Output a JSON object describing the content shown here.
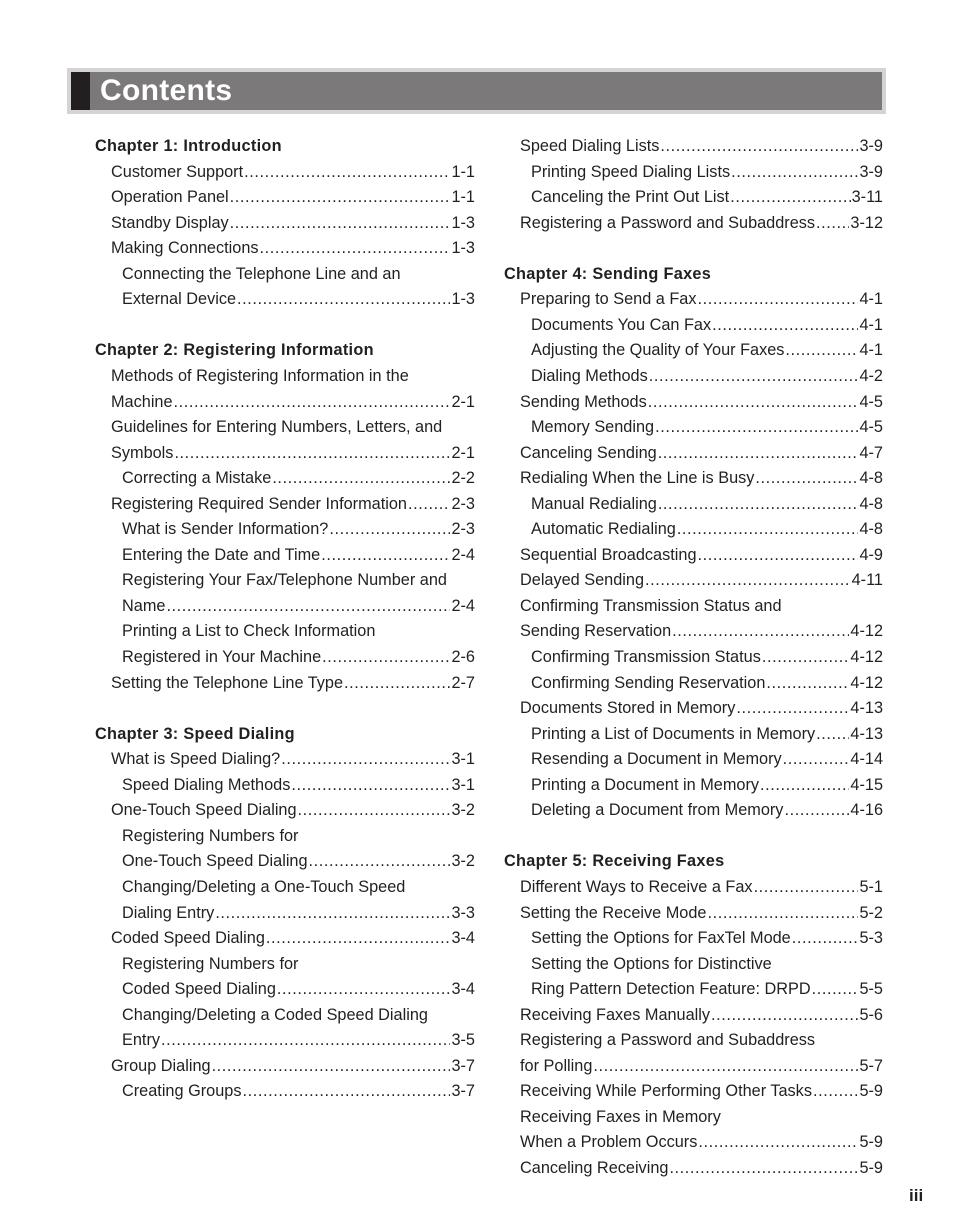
{
  "header": {
    "title": "Contents"
  },
  "page_number": "iii",
  "columns": [
    {
      "lines": [
        {
          "type": "chapter",
          "text": "Chapter 1: Introduction"
        },
        {
          "type": "entry",
          "level": 1,
          "text": "Customer Support",
          "page": "1-1"
        },
        {
          "type": "entry",
          "level": 1,
          "text": "Operation Panel",
          "page": "1-1"
        },
        {
          "type": "entry",
          "level": 1,
          "text": "Standby Display",
          "page": "1-3"
        },
        {
          "type": "entry",
          "level": 1,
          "text": "Making Connections",
          "page": "1-3"
        },
        {
          "type": "text",
          "level": 2,
          "text": "Connecting the Telephone Line and an"
        },
        {
          "type": "entry",
          "level": 2,
          "text": "External Device",
          "page": "1-3"
        },
        {
          "type": "blank"
        },
        {
          "type": "chapter",
          "text": "Chapter 2: Registering Information"
        },
        {
          "type": "text",
          "level": 1,
          "text": "Methods of Registering Information in the"
        },
        {
          "type": "entry",
          "level": 1,
          "text": "Machine",
          "page": "2-1"
        },
        {
          "type": "text",
          "level": 1,
          "text": "Guidelines for Entering Numbers, Letters, and"
        },
        {
          "type": "entry",
          "level": 1,
          "text": "Symbols",
          "page": "2-1"
        },
        {
          "type": "entry",
          "level": 2,
          "text": "Correcting a Mistake",
          "page": "2-2"
        },
        {
          "type": "entry",
          "level": 1,
          "text": "Registering Required Sender Information",
          "page": "2-3"
        },
        {
          "type": "entry",
          "level": 2,
          "text": "What is Sender Information?",
          "page": "2-3"
        },
        {
          "type": "entry",
          "level": 2,
          "text": "Entering the Date and Time",
          "page": "2-4"
        },
        {
          "type": "text",
          "level": 2,
          "text": "Registering Your Fax/Telephone Number and"
        },
        {
          "type": "entry",
          "level": 2,
          "text": "Name",
          "page": "2-4"
        },
        {
          "type": "text",
          "level": 2,
          "text": "Printing a List to Check Information"
        },
        {
          "type": "entry",
          "level": 2,
          "text": "Registered in Your Machine",
          "page": "2-6"
        },
        {
          "type": "entry",
          "level": 1,
          "text": "Setting the Telephone Line Type",
          "page": "2-7"
        },
        {
          "type": "blank"
        },
        {
          "type": "chapter",
          "text": "Chapter 3: Speed Dialing"
        },
        {
          "type": "entry",
          "level": 1,
          "text": "What is Speed Dialing?",
          "page": "3-1"
        },
        {
          "type": "entry",
          "level": 2,
          "text": "Speed Dialing Methods",
          "page": "3-1"
        },
        {
          "type": "entry",
          "level": 1,
          "text": "One-Touch Speed Dialing",
          "page": "3-2"
        },
        {
          "type": "text",
          "level": 2,
          "text": "Registering Numbers for"
        },
        {
          "type": "entry",
          "level": 2,
          "text": "One-Touch Speed Dialing",
          "page": "3-2"
        },
        {
          "type": "text",
          "level": 2,
          "text": "Changing/Deleting a One-Touch Speed"
        },
        {
          "type": "entry",
          "level": 2,
          "text": "Dialing Entry",
          "page": "3-3"
        },
        {
          "type": "entry",
          "level": 1,
          "text": "Coded Speed Dialing",
          "page": "3-4"
        },
        {
          "type": "text",
          "level": 2,
          "text": "Registering Numbers for"
        },
        {
          "type": "entry",
          "level": 2,
          "text": "Coded Speed Dialing",
          "page": "3-4"
        },
        {
          "type": "text",
          "level": 2,
          "text": "Changing/Deleting a Coded Speed Dialing"
        },
        {
          "type": "entry",
          "level": 2,
          "text": "Entry",
          "page": "3-5"
        },
        {
          "type": "entry",
          "level": 1,
          "text": "Group Dialing",
          "page": "3-7"
        },
        {
          "type": "entry",
          "level": 2,
          "text": "Creating Groups",
          "page": "3-7"
        }
      ]
    },
    {
      "lines": [
        {
          "type": "entry",
          "level": 1,
          "text": "Speed Dialing Lists",
          "page": "3-9"
        },
        {
          "type": "entry",
          "level": 2,
          "text": "Printing Speed Dialing Lists",
          "page": "3-9"
        },
        {
          "type": "entry",
          "level": 2,
          "text": "Canceling the Print Out List",
          "page": "3-11"
        },
        {
          "type": "entry",
          "level": 1,
          "text": "Registering a Password and Subaddress",
          "page": "3-12"
        },
        {
          "type": "blank"
        },
        {
          "type": "chapter",
          "text": "Chapter 4: Sending Faxes"
        },
        {
          "type": "entry",
          "level": 1,
          "text": "Preparing to Send a Fax",
          "page": "4-1"
        },
        {
          "type": "entry",
          "level": 2,
          "text": "Documents You Can Fax",
          "page": "4-1"
        },
        {
          "type": "entry",
          "level": 2,
          "text": "Adjusting the Quality of Your Faxes",
          "page": "4-1"
        },
        {
          "type": "entry",
          "level": 2,
          "text": "Dialing Methods",
          "page": "4-2"
        },
        {
          "type": "entry",
          "level": 1,
          "text": "Sending Methods",
          "page": "4-5"
        },
        {
          "type": "entry",
          "level": 2,
          "text": "Memory Sending",
          "page": "4-5"
        },
        {
          "type": "entry",
          "level": 1,
          "text": "Canceling Sending",
          "page": "4-7"
        },
        {
          "type": "entry",
          "level": 1,
          "text": "Redialing When the Line is Busy",
          "page": "4-8"
        },
        {
          "type": "entry",
          "level": 2,
          "text": "Manual Redialing",
          "page": "4-8"
        },
        {
          "type": "entry",
          "level": 2,
          "text": "Automatic Redialing",
          "page": "4-8"
        },
        {
          "type": "entry",
          "level": 1,
          "text": "Sequential Broadcasting",
          "page": "4-9"
        },
        {
          "type": "entry",
          "level": 1,
          "text": "Delayed Sending",
          "page": "4-11"
        },
        {
          "type": "text",
          "level": 1,
          "text": "Confirming Transmission Status and"
        },
        {
          "type": "entry",
          "level": 1,
          "text": "Sending Reservation",
          "page": "4-12"
        },
        {
          "type": "entry",
          "level": 2,
          "text": "Confirming Transmission Status",
          "page": "4-12"
        },
        {
          "type": "entry",
          "level": 2,
          "text": "Confirming Sending Reservation",
          "page": "4-12"
        },
        {
          "type": "entry",
          "level": 1,
          "text": "Documents Stored in Memory",
          "page": "4-13"
        },
        {
          "type": "entry",
          "level": 2,
          "text": "Printing a List of Documents in Memory",
          "page": "4-13"
        },
        {
          "type": "entry",
          "level": 2,
          "text": "Resending a Document in Memory",
          "page": "4-14"
        },
        {
          "type": "entry",
          "level": 2,
          "text": "Printing a Document in Memory",
          "page": "4-15"
        },
        {
          "type": "entry",
          "level": 2,
          "text": "Deleting a Document from Memory",
          "page": "4-16"
        },
        {
          "type": "blank"
        },
        {
          "type": "chapter",
          "text": "Chapter 5: Receiving Faxes"
        },
        {
          "type": "entry",
          "level": 1,
          "text": "Different Ways to Receive a Fax",
          "page": "5-1"
        },
        {
          "type": "entry",
          "level": 1,
          "text": "Setting the Receive Mode",
          "page": "5-2"
        },
        {
          "type": "entry",
          "level": 2,
          "text": "Setting the Options for FaxTel Mode",
          "page": "5-3"
        },
        {
          "type": "text",
          "level": 2,
          "text": "Setting the Options for Distinctive"
        },
        {
          "type": "entry",
          "level": 2,
          "text": "Ring Pattern Detection Feature: DRPD",
          "page": "5-5"
        },
        {
          "type": "entry",
          "level": 1,
          "text": "Receiving Faxes Manually",
          "page": "5-6"
        },
        {
          "type": "text",
          "level": 1,
          "text": "Registering a Password and Subaddress"
        },
        {
          "type": "entry",
          "level": 1,
          "text": "for Polling",
          "page": "5-7"
        },
        {
          "type": "entry",
          "level": 1,
          "text": "Receiving While Performing Other Tasks",
          "page": "5-9"
        },
        {
          "type": "text",
          "level": 1,
          "text": "Receiving Faxes in Memory"
        },
        {
          "type": "entry",
          "level": 1,
          "text": "When a Problem Occurs",
          "page": "5-9"
        },
        {
          "type": "entry",
          "level": 1,
          "text": "Canceling Receiving",
          "page": "5-9"
        }
      ]
    }
  ]
}
